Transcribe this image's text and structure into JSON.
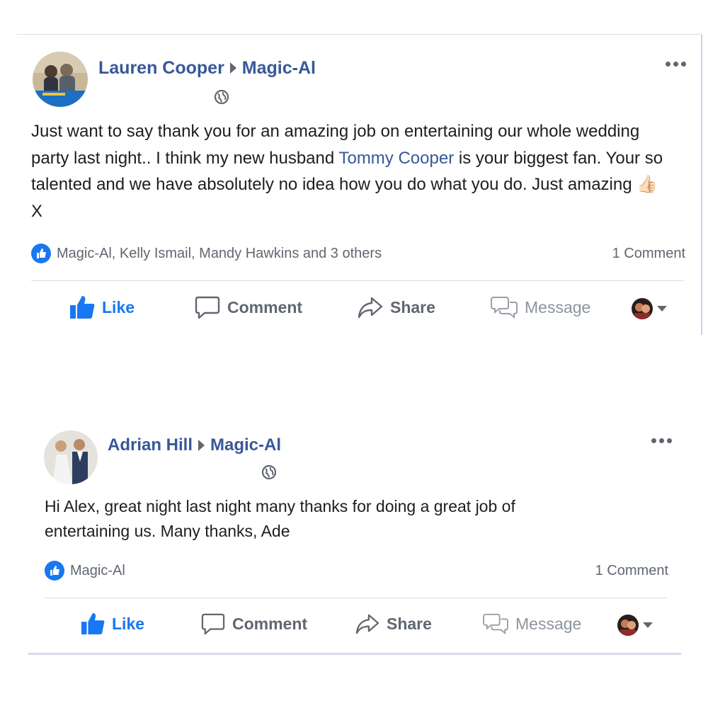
{
  "posts": [
    {
      "author": "Lauren Cooper",
      "page": "Magic-Al",
      "text_parts": {
        "before": "Just want to say thank you for an amazing job on entertaining our whole wedding party last night.. I think my new husband ",
        "mention": "Tommy Cooper",
        "after": " is your biggest fan. Your so talented and we have absolutely no idea how you do what you do. Just amazing ",
        "emoji": "👍🏻",
        "end": " X"
      },
      "reactions_text": "Magic-Al, Kelly Ismail, Mandy Hawkins and 3 others",
      "comments_text": "1 Comment",
      "actions": {
        "like": "Like",
        "comment": "Comment",
        "share": "Share",
        "message": "Message"
      }
    },
    {
      "author": "Adrian Hill",
      "page": "Magic-Al",
      "text": "Hi Alex, great night last night many thanks for doing a great job of entertaining us. Many thanks, Ade",
      "reactions_text": "Magic-Al",
      "comments_text": "1 Comment",
      "actions": {
        "like": "Like",
        "comment": "Comment",
        "share": "Share",
        "message": "Message"
      }
    }
  ],
  "colors": {
    "link": "#385898",
    "accent": "#1877f2",
    "muted": "#606770",
    "text": "#1c1e21"
  },
  "icons": [
    "globe-icon",
    "more-icon",
    "like-thumb-icon",
    "comment-icon",
    "share-icon",
    "message-icon",
    "caret-down-icon"
  ]
}
